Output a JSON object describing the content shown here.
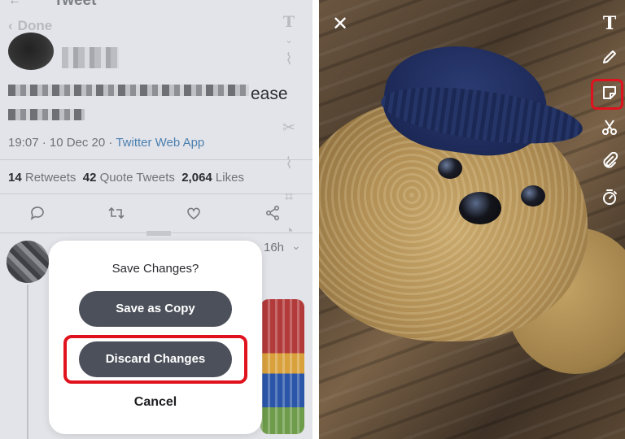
{
  "twitter": {
    "header_title": "Tweet",
    "done_label": "Done",
    "tweet_text_tail": "ease",
    "meta": {
      "time": "19:07 · 10 Dec 20 · ",
      "via": "Twitter Web App"
    },
    "stats": {
      "retweets_count": "14",
      "retweets_label": " Retweets",
      "quotes_count": "42",
      "quotes_label": " Quote Tweets",
      "likes_count": "2,064",
      "likes_label": " Likes"
    },
    "reply_time": "16h"
  },
  "dialog": {
    "title": "Save Changes?",
    "save_copy_label": "Save as Copy",
    "discard_label": "Discard Changes",
    "cancel_label": "Cancel",
    "highlight_color": "#e0121d"
  },
  "editor": {
    "tools": [
      {
        "name": "text-icon"
      },
      {
        "name": "pencil-icon"
      },
      {
        "name": "sticker-icon"
      },
      {
        "name": "scissors-icon"
      },
      {
        "name": "paperclip-icon"
      },
      {
        "name": "timer-icon"
      }
    ],
    "text_tool_glyph": "T",
    "close_glyph": "✕"
  }
}
